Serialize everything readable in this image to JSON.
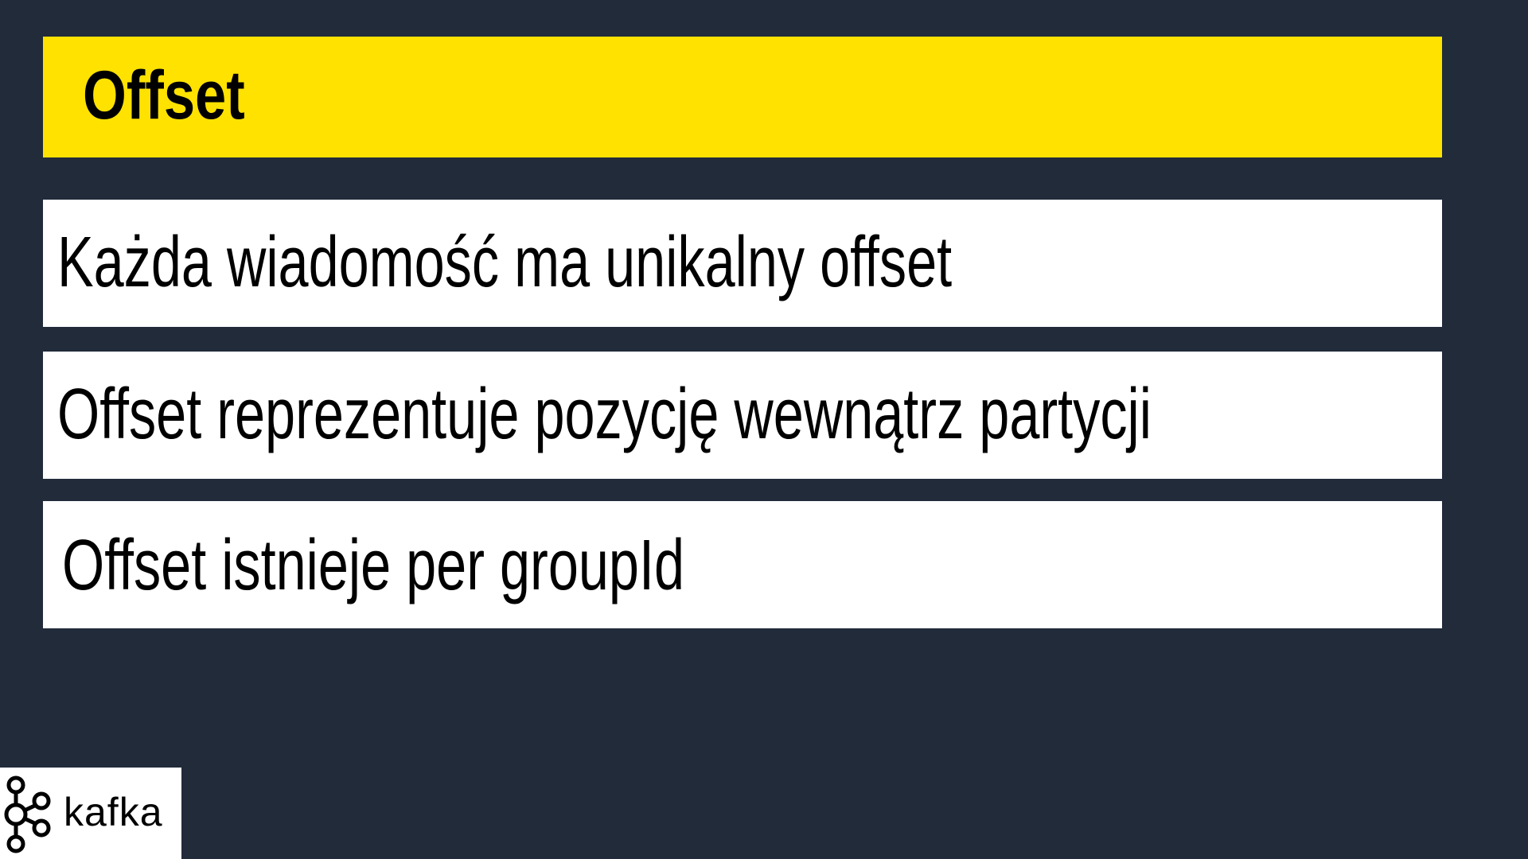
{
  "slide": {
    "title": "Offset",
    "points": [
      "Każda wiadomość ma unikalny offset",
      "Offset reprezentuje pozycję wewnątrz partycji",
      "Offset istnieje per groupId"
    ]
  },
  "logo": {
    "text": "kafka",
    "icon": "kafka-logo-icon"
  },
  "colors": {
    "background": "#212b3a",
    "title_bar": "#ffe200",
    "card": "#ffffff",
    "text": "#000000"
  }
}
